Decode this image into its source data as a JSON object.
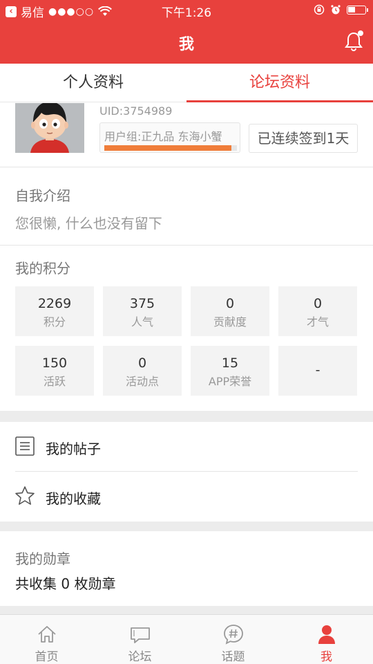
{
  "status_bar": {
    "carrier": "易信",
    "signal": "●●●○○",
    "time": "下午1:26"
  },
  "header": {
    "title": "我"
  },
  "tabs": [
    {
      "label": "个人资料",
      "active": false
    },
    {
      "label": "论坛资料",
      "active": true
    }
  ],
  "profile": {
    "uid": "UID:3754989",
    "group": "用户组:正九品  东海小蟹",
    "group_progress": 0.96,
    "checkin": "已连续签到1天"
  },
  "intro": {
    "title": "自我介绍",
    "text": "您很懒, 什么也没有留下"
  },
  "points": {
    "title": "我的积分",
    "items": [
      {
        "value": "2269",
        "label": "积分"
      },
      {
        "value": "375",
        "label": "人气"
      },
      {
        "value": "0",
        "label": "贡献度"
      },
      {
        "value": "0",
        "label": "才气"
      },
      {
        "value": "150",
        "label": "活跃"
      },
      {
        "value": "0",
        "label": "活动点"
      },
      {
        "value": "15",
        "label": "APP荣誉"
      },
      {
        "value": "-",
        "label": ""
      }
    ]
  },
  "menu": {
    "posts": "我的帖子",
    "favorites": "我的收藏"
  },
  "medals": {
    "title": "我的勋章",
    "text": "共收集 0 枚勋章"
  },
  "tabbar": [
    {
      "label": "首页",
      "icon": "home-icon"
    },
    {
      "label": "论坛",
      "icon": "chat-icon"
    },
    {
      "label": "话题",
      "icon": "hashtag-icon"
    },
    {
      "label": "我",
      "icon": "person-icon"
    }
  ],
  "colors": {
    "accent": "#e8413d",
    "progress": "#f07d3a"
  }
}
